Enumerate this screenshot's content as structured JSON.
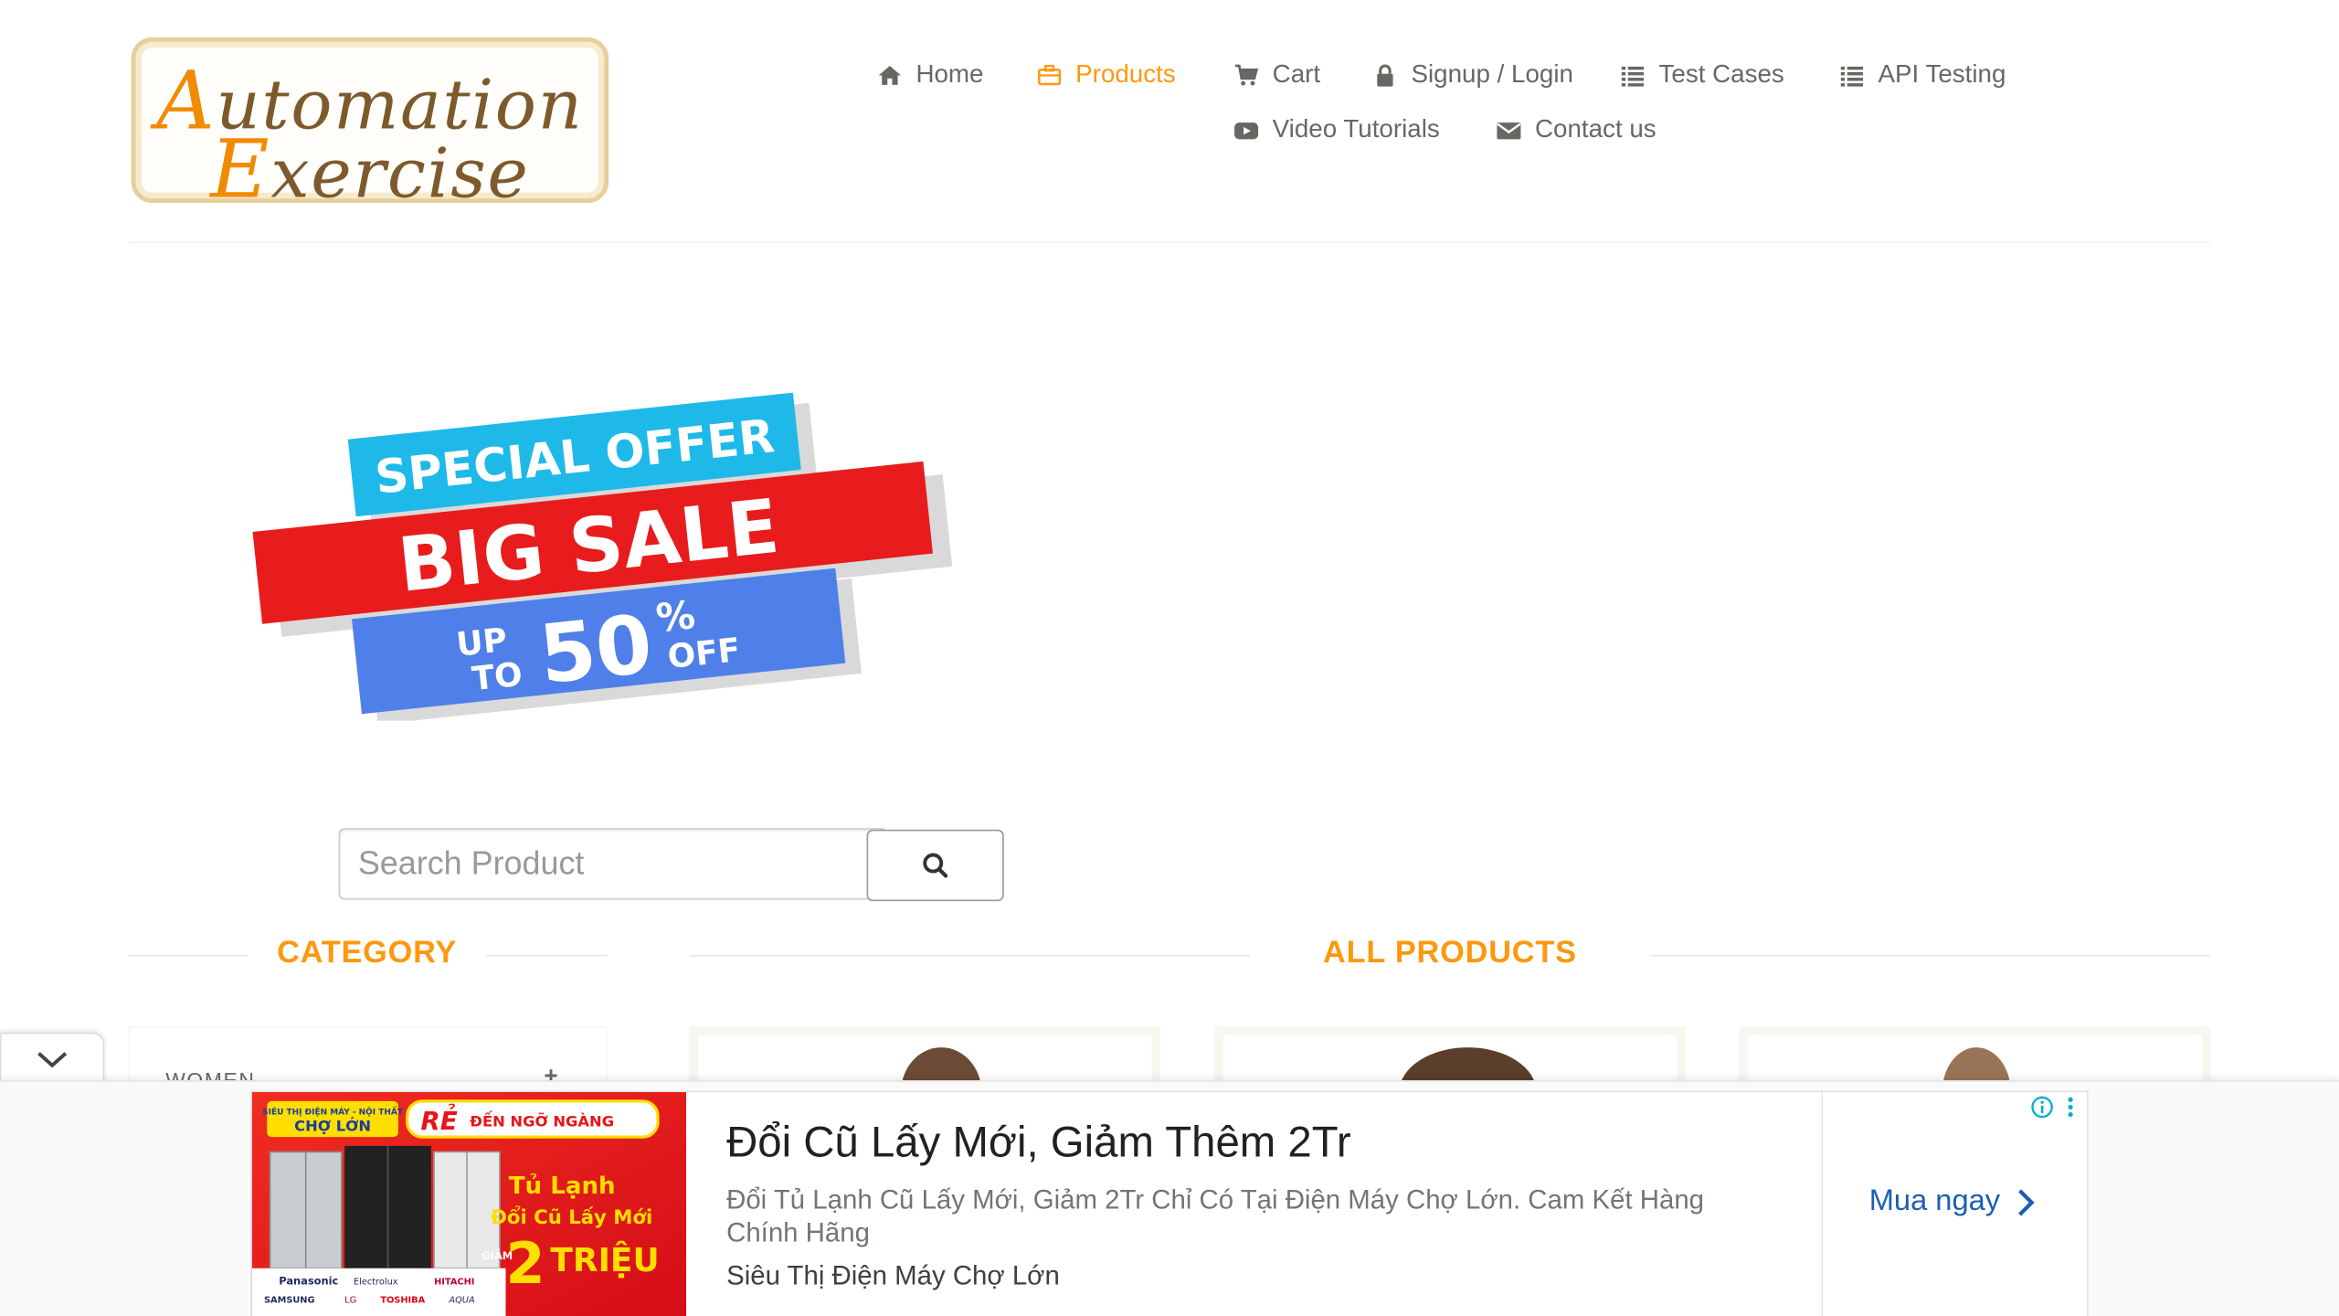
{
  "logo": {
    "line1_first": "A",
    "line1_rest": "utomation",
    "line2_first": "E",
    "line2_rest": "xercise"
  },
  "nav": {
    "items": [
      {
        "label": "Home",
        "icon": "home-icon",
        "active": false
      },
      {
        "label": "Products",
        "icon": "briefcase-icon",
        "active": true
      },
      {
        "label": "Cart",
        "icon": "cart-icon",
        "active": false
      },
      {
        "label": "Signup / Login",
        "icon": "lock-icon",
        "active": false
      },
      {
        "label": "Test Cases",
        "icon": "list-icon",
        "active": false
      },
      {
        "label": "API Testing",
        "icon": "list-icon",
        "active": false
      },
      {
        "label": "Video Tutorials",
        "icon": "youtube-play-icon",
        "active": false
      },
      {
        "label": "Contact us",
        "icon": "envelope-icon",
        "active": false
      }
    ]
  },
  "banner": {
    "special_offer": "SPECIAL OFFER",
    "big_sale": "BIG SALE",
    "up": "UP",
    "to": "TO",
    "percent_value": "50",
    "percent_sign": "%",
    "off": "OFF"
  },
  "search": {
    "placeholder": "Search Product",
    "icon": "search-icon"
  },
  "sidebar": {
    "title": "CATEGORY",
    "first_category": "WOMEN",
    "expand": "+"
  },
  "main": {
    "title": "ALL PRODUCTS"
  },
  "ad": {
    "headline": "Đổi Cũ Lấy Mới, Giảm Thêm 2Tr",
    "description": "Đổi Tủ Lạnh Cũ Lấy Mới, Giảm 2Tr Chỉ Có Tại Điện Máy Chợ Lớn. Cam Kết Hàng Chính Hãng",
    "advertiser": "Siêu Thị Điện Máy Chợ Lớn",
    "cta": "Mua ngay",
    "image": {
      "store_tag_top": "SIÊU THỊ ĐIỆN MÁY - NỘI THẤT",
      "store_name": "CHỢ LỚN",
      "slogan_re": "RẺ",
      "slogan_rest": "ĐẾN NGỠ NGÀNG",
      "product": "Tủ Lạnh",
      "promo": "Đổi Cũ Lấy Mới",
      "discount_prefix": "GIẢM",
      "discount_value": "2",
      "discount_unit": "TRIỆU",
      "brands_row1": [
        "Panasonic",
        "Electrolux",
        "HITACHI"
      ],
      "brands_row2": [
        "SAMSUNG",
        "LG",
        "TOSHIBA",
        "AQUA"
      ]
    }
  },
  "colors": {
    "accent": "#fe980f",
    "nav_text": "#696763",
    "ad_cta": "#1a5fb4"
  }
}
